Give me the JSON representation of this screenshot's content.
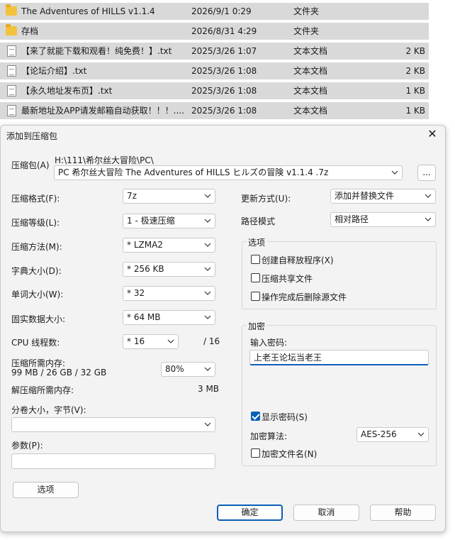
{
  "files": [
    {
      "name": "The Adventures of HILLS v1.1.4",
      "date": "2026/9/1 0:29",
      "type": "文件夹",
      "size": "",
      "icon": "folder-icon"
    },
    {
      "name": "存档",
      "date": "2026/8/31 4:29",
      "type": "文件夹",
      "size": "",
      "icon": "folder-icon"
    },
    {
      "name": "【来了就能下载和观看！纯免费！】.txt",
      "date": "2025/3/26 1:07",
      "type": "文本文档",
      "size": "2 KB",
      "icon": "text-file-icon"
    },
    {
      "name": "【论坛介绍】.txt",
      "date": "2025/3/26 1:08",
      "type": "文本文档",
      "size": "2 KB",
      "icon": "text-file-icon"
    },
    {
      "name": "【永久地址发布页】.txt",
      "date": "2025/3/26 1:08",
      "type": "文本文档",
      "size": "1 KB",
      "icon": "text-file-icon"
    },
    {
      "name": "最新地址及APP请发邮箱自动获取！！！....",
      "date": "2025/3/26 1:08",
      "type": "文本文档",
      "size": "1 KB",
      "icon": "text-file-icon"
    }
  ],
  "dialog": {
    "title": "添加到压缩包",
    "archive": {
      "label": "压缩包(A)",
      "path": "H:\\111\\希尔丝大冒险\\PC\\",
      "value": "PC 希尔丝大冒险 The Adventures of HILLS ヒルズの冒険 v1.1.4 .7z",
      "browse": "..."
    },
    "left": {
      "format": {
        "label": "压缩格式(F):",
        "value": "7z"
      },
      "level": {
        "label": "压缩等级(L):",
        "value": "1 - 极速压缩"
      },
      "method": {
        "label": "压缩方法(M):",
        "value": "*  LZMA2"
      },
      "dict": {
        "label": "字典大小(D):",
        "value": "*  256 KB"
      },
      "word": {
        "label": "单词大小(W):",
        "value": "*  32"
      },
      "solid": {
        "label": "固实数据大小:",
        "value": "*  64 MB"
      },
      "threads": {
        "label": "CPU 线程数:",
        "value": "*  16",
        "max": "/ 16"
      },
      "mem_compress": {
        "label": "压缩所需内存:",
        "detail": "99 MB / 26 GB / 32 GB",
        "percent": "80%"
      },
      "mem_decompress": {
        "label": "解压缩所需内存:",
        "value": "3 MB"
      },
      "split": {
        "label": "分卷大小，字节(V):",
        "value": ""
      },
      "params": {
        "label": "参数(P):",
        "value": ""
      },
      "options_button": "选项"
    },
    "right": {
      "update": {
        "label": "更新方式(U):",
        "value": "添加并替换文件"
      },
      "path_mode": {
        "label": "路径模式",
        "value": "相对路径"
      },
      "options": {
        "title": "选项",
        "sfx": {
          "label": "创建自释放程序(X)",
          "checked": false
        },
        "shared": {
          "label": "压缩共享文件",
          "checked": false
        },
        "delete": {
          "label": "操作完成后删除源文件",
          "checked": false
        }
      },
      "encryption": {
        "title": "加密",
        "password_label": "输入密码:",
        "password": "上老王论坛当老王",
        "show": {
          "label": "显示密码(S)",
          "checked": true
        },
        "method_label": "加密算法:",
        "method": "AES-256",
        "encrypt_names": {
          "label": "加密文件名(N)",
          "checked": false
        }
      }
    },
    "buttons": {
      "ok": "确定",
      "cancel": "取消",
      "help": "帮助"
    }
  },
  "colors": {
    "accent": "#0a5fb6",
    "row_bg": "#d9d9d9",
    "dialog_bg": "#f3f3f3"
  }
}
